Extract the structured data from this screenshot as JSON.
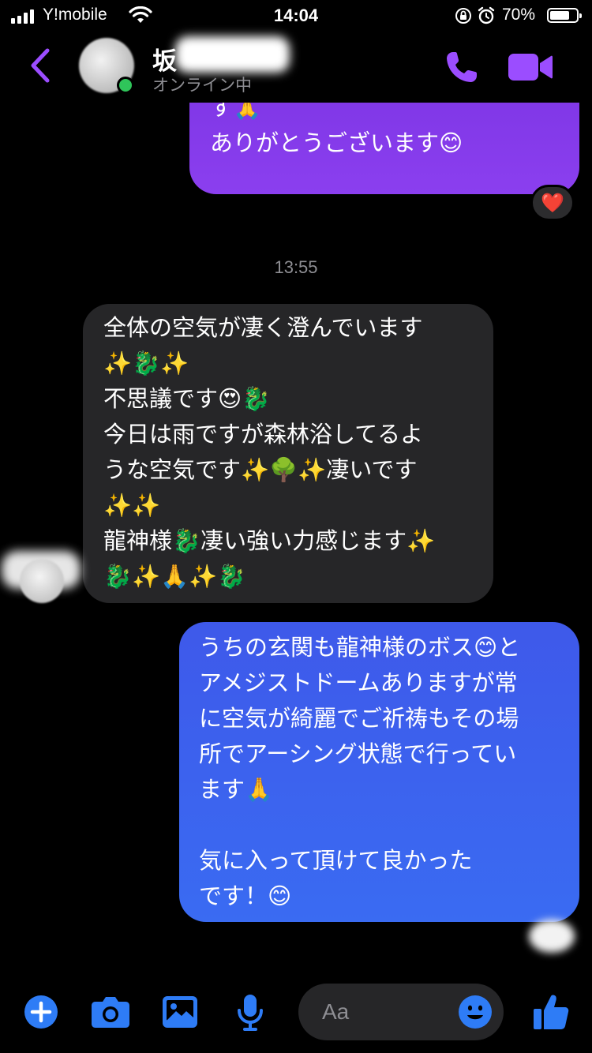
{
  "status_bar": {
    "carrier": "Y!mobile",
    "time": "14:04",
    "battery": "70%"
  },
  "header": {
    "contact_name": "坂",
    "contact_status": "オンライン中"
  },
  "messages": [
    {
      "direction": "sent",
      "text": "す🙏\nありがとうございます😊",
      "reaction": "❤️"
    },
    {
      "direction": "received",
      "text": "全体の空気が凄く澄んでいます\n✨🐉✨\n不思議です😍🐉\n今日は雨ですが森林浴してるよ\nうな空気です✨🌳✨凄いです\n✨✨\n龍神様🐉凄い強い力感じます✨\n🐉✨🙏✨🐉"
    },
    {
      "direction": "sent",
      "text": "うちの玄関も龍神様のボス😊と\nアメジストドームありますが常\nに空気が綺麗でご祈祷もその場\n所でアーシング状態で行ってい\nます🙏\n\n気に入って頂けて良かった\nです！😊"
    }
  ],
  "timestamp": "13:55",
  "composer": {
    "placeholder": "Aa"
  },
  "colors": {
    "accent_purple": "#9b4dff",
    "composer_blue": "#2e7cf6",
    "bubble_purple": "#8036e8",
    "bubble_blue": "#3d62ef",
    "bubble_received": "#262628"
  },
  "icons": [
    "back-icon",
    "phone-icon",
    "video-icon",
    "plus-icon",
    "camera-icon",
    "image-icon",
    "mic-icon",
    "emoji-icon",
    "thumbs-up-icon"
  ]
}
